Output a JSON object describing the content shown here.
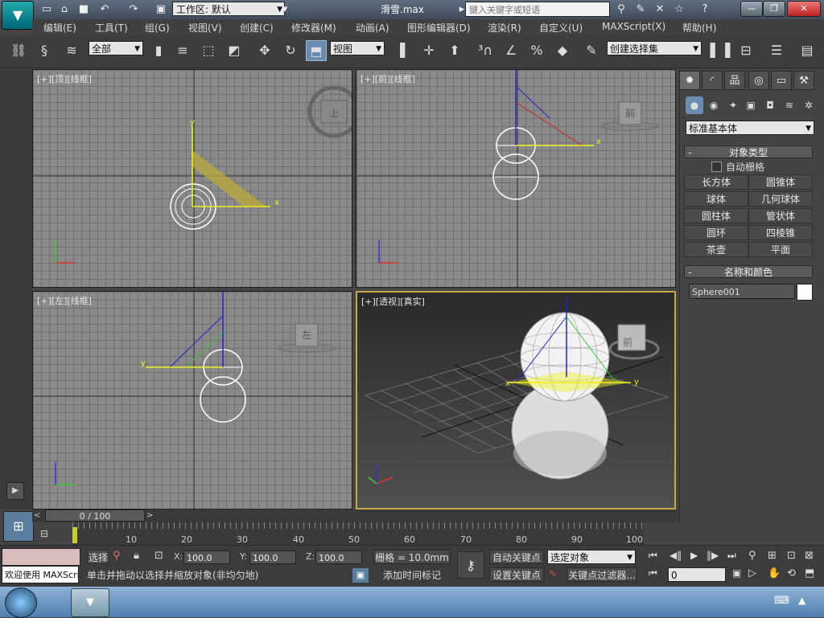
{
  "title_bar": {
    "workspace": "工作区: 默认",
    "doc_title": "滑雪.max",
    "search_placeholder": "键入关键字或短语"
  },
  "menu": [
    "编辑(E)",
    "工具(T)",
    "组(G)",
    "视图(V)",
    "创建(C)",
    "修改器(M)",
    "动画(A)",
    "图形编辑器(D)",
    "渲染(R)",
    "自定义(U)",
    "MAXScript(X)",
    "帮助(H)"
  ],
  "toolbar": {
    "filter": "全部",
    "ref_coord": "视图",
    "selection_set": "创建选择集"
  },
  "viewports": {
    "top": "[+][顶][线框]",
    "front": "[+][前][线框]",
    "left": "[+][左][线框]",
    "persp": "[+][透视][真实]",
    "cube_top": "上",
    "cube_front": "前",
    "cube_left": "左",
    "cube_persp": "前"
  },
  "command_panel": {
    "category": "标准基本体",
    "object_type_title": "对象类型",
    "auto_grid": "自动栅格",
    "primitives": [
      "长方体",
      "圆锥体",
      "球体",
      "几何球体",
      "圆柱体",
      "管状体",
      "圆环",
      "四棱锥",
      "茶壶",
      "平面"
    ],
    "name_color_title": "名称和颜色",
    "object_name": "Sphere001",
    "object_color": "#ffffff"
  },
  "timeline": {
    "position": "0 / 100",
    "ticks": [
      "10",
      "20",
      "30",
      "40",
      "50",
      "60",
      "70",
      "80",
      "90",
      "100"
    ]
  },
  "status": {
    "listener": "欢迎使用 MAXScri",
    "select_label": "选择",
    "x_label": "X:",
    "y_label": "Y:",
    "z_label": "Z:",
    "x": "100.0",
    "y": "100.0",
    "z": "100.0",
    "grid": "栅格 = 10.0mm",
    "prompt": "单击并拖动以选择并缩放对象(非均匀地)",
    "add_time_tag": "添加时间标记",
    "auto_key": "自动关键点",
    "set_key": "设置关键点",
    "key_mode": "选定对象",
    "key_filters": "关键点过滤器...",
    "frame": "0"
  }
}
